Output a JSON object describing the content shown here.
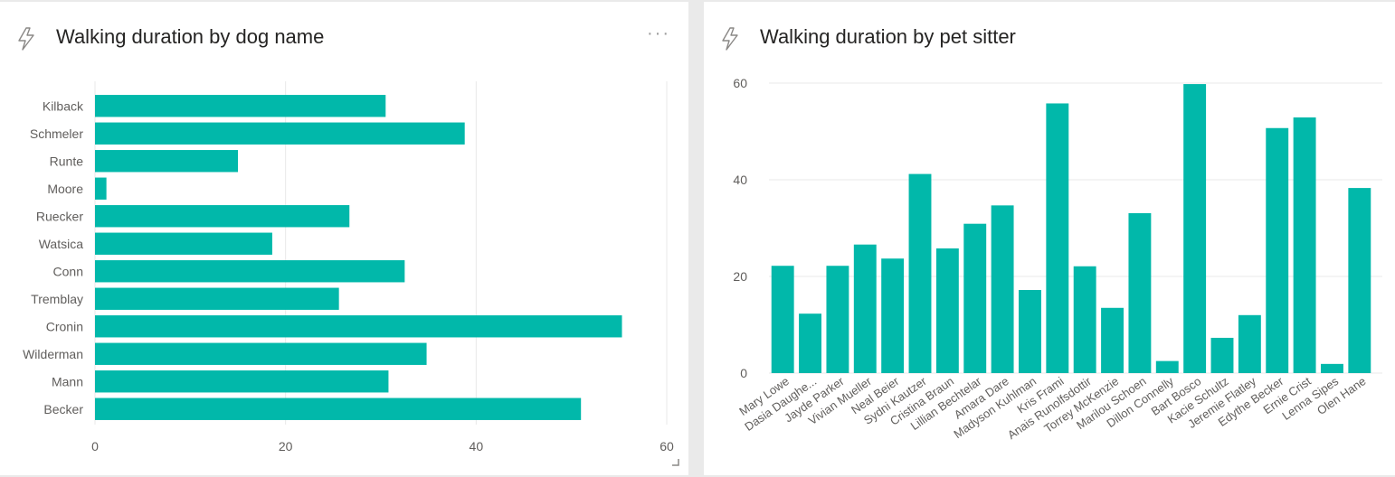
{
  "colors": {
    "bar": "#01b8aa",
    "grid": "#e8e8e8",
    "tick": "#605e5c",
    "title": "#252423"
  },
  "tiles": {
    "left": {
      "title": "Walking duration by dog name",
      "icon": "bolt-icon",
      "menu_icon": "more-icon",
      "menu_label": "···"
    },
    "right": {
      "title": "Walking duration by pet sitter",
      "icon": "bolt-icon"
    }
  },
  "chart_data": [
    {
      "type": "bar",
      "orientation": "horizontal",
      "title": "Walking duration by dog name",
      "categories": [
        "Kilback",
        "Schmeler",
        "Runte",
        "Moore",
        "Ruecker",
        "Watsica",
        "Conn",
        "Tremblay",
        "Cronin",
        "Wilderman",
        "Mann",
        "Becker"
      ],
      "values": [
        30.5,
        38.8,
        15,
        1.2,
        26.7,
        18.6,
        32.5,
        25.6,
        55.3,
        34.8,
        30.8,
        51
      ],
      "xlim": [
        0,
        60
      ],
      "xticks": [
        "0",
        "20",
        "40",
        "60"
      ],
      "grid": true
    },
    {
      "type": "bar",
      "orientation": "vertical",
      "title": "Walking duration by pet sitter",
      "categories": [
        "Mary Lowe",
        "Dasia Daughe...",
        "Jayde Parker",
        "Vivian Mueller",
        "Neal Beier",
        "Sydni Kautzer",
        "Cristina Braun",
        "Lillian Bechtelar",
        "Amara Dare",
        "Madyson Kuhlman",
        "Kris Frami",
        "Anais Runolfsdottir",
        "Torrey McKenzie",
        "Marilou Schoen",
        "Dillon Connelly",
        "Bart Bosco",
        "Kacie Schultz",
        "Jeremie Flatley",
        "Edythe Becker",
        "Ernie Crist",
        "Lenna Sipes",
        "Olen Hane"
      ],
      "values": [
        22.2,
        12.3,
        22.2,
        26.6,
        23.7,
        41.2,
        25.8,
        30.9,
        34.7,
        17.2,
        55.8,
        22.1,
        13.5,
        33.1,
        2.5,
        59.8,
        7.3,
        12,
        50.7,
        52.9,
        1.9,
        38.3
      ],
      "ylim": [
        0,
        60
      ],
      "yticks": [
        "0",
        "20",
        "40",
        "60"
      ],
      "grid": true
    }
  ]
}
